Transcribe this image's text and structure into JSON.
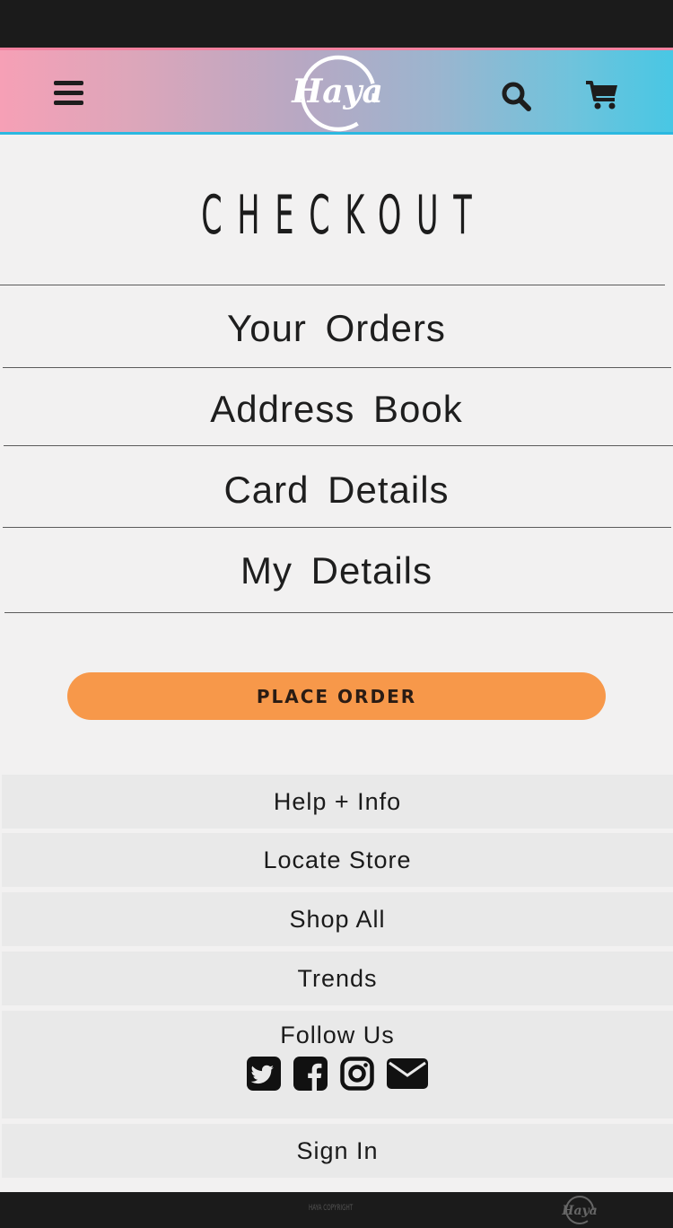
{
  "header": {
    "logo_text": "Haya",
    "menu_icon": "hamburger-menu-icon",
    "search_icon": "search-icon",
    "cart_icon": "shopping-cart-icon",
    "gradient_colors": [
      "#f6a0b6",
      "#48c7e4"
    ]
  },
  "page": {
    "title": "CHECKOUT"
  },
  "sections": [
    {
      "label": "Your Orders"
    },
    {
      "label": "Address Book"
    },
    {
      "label": "Card Details"
    },
    {
      "label": "My Details"
    }
  ],
  "actions": {
    "place_order_label": "PLACE ORDER",
    "place_order_color": "#f7984a"
  },
  "footer": {
    "links": [
      {
        "label": "Help + Info"
      },
      {
        "label": "Locate Store"
      },
      {
        "label": "Shop All"
      },
      {
        "label": "Trends"
      }
    ],
    "follow_label": "Follow Us",
    "social_icons": [
      "twitter-icon",
      "facebook-icon",
      "instagram-icon",
      "email-icon"
    ],
    "sign_in_label": "Sign In",
    "copyright": "HAYA COPYRIGHT",
    "logo_text": "Haya"
  }
}
